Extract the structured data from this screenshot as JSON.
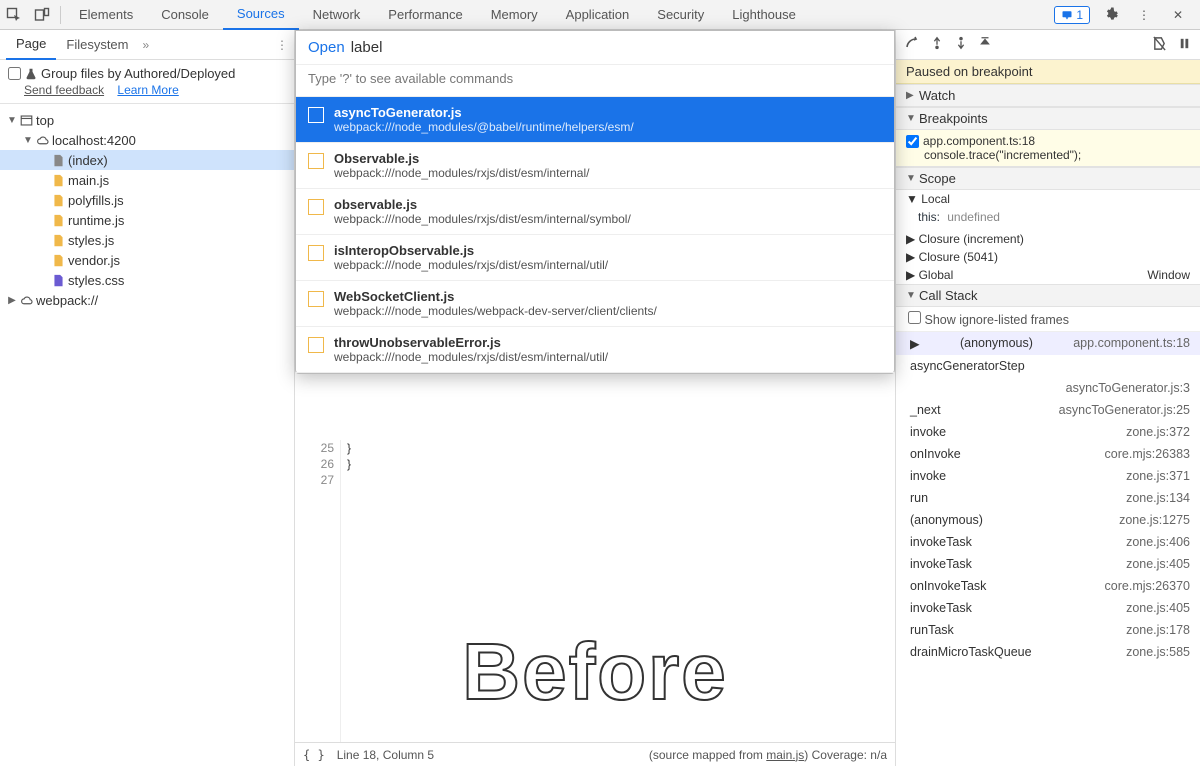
{
  "topTabs": [
    "Elements",
    "Console",
    "Sources",
    "Network",
    "Performance",
    "Memory",
    "Application",
    "Security",
    "Lighthouse"
  ],
  "activeTopTab": "Sources",
  "badgeCount": "1",
  "sidebar": {
    "tabs": [
      "Page",
      "Filesystem"
    ],
    "activeTab": "Page",
    "groupLabel": "Group files by Authored/Deployed",
    "feedback": "Send feedback",
    "learn": "Learn More",
    "tree": [
      {
        "depth": 0,
        "tw": "▼",
        "icon": "window",
        "label": "top"
      },
      {
        "depth": 1,
        "tw": "▼",
        "icon": "cloud",
        "label": "localhost:4200"
      },
      {
        "depth": 2,
        "tw": "",
        "icon": "file",
        "label": "(index)",
        "selected": true
      },
      {
        "depth": 2,
        "tw": "",
        "icon": "js",
        "label": "main.js"
      },
      {
        "depth": 2,
        "tw": "",
        "icon": "js",
        "label": "polyfills.js"
      },
      {
        "depth": 2,
        "tw": "",
        "icon": "js",
        "label": "runtime.js"
      },
      {
        "depth": 2,
        "tw": "",
        "icon": "js",
        "label": "styles.js"
      },
      {
        "depth": 2,
        "tw": "",
        "icon": "js",
        "label": "vendor.js"
      },
      {
        "depth": 2,
        "tw": "",
        "icon": "css",
        "label": "styles.css"
      },
      {
        "depth": 0,
        "tw": "▶",
        "icon": "cloud",
        "label": "webpack://"
      }
    ]
  },
  "popup": {
    "prefix": "Open",
    "query": "label",
    "hint": "Type '?' to see available commands",
    "items": [
      {
        "title": "asyncToGenerator.js",
        "path": "webpack:///node_modules/@babel/runtime/helpers/esm/",
        "sel": true
      },
      {
        "title": "Observable.js",
        "path": "webpack:///node_modules/rxjs/dist/esm/internal/"
      },
      {
        "title": "observable.js",
        "path": "webpack:///node_modules/rxjs/dist/esm/internal/symbol/"
      },
      {
        "title": "isInteropObservable.js",
        "path": "webpack:///node_modules/rxjs/dist/esm/internal/util/"
      },
      {
        "title": "WebSocketClient.js",
        "path": "webpack:///node_modules/webpack-dev-server/client/clients/"
      },
      {
        "title": "throwUnobservableError.js",
        "path": "webpack:///node_modules/rxjs/dist/esm/internal/util/"
      }
    ]
  },
  "code": {
    "startLine": 25,
    "lines": [
      "  }",
      "}",
      ""
    ]
  },
  "status": {
    "pos": "Line 18, Column 5",
    "mapped": "(source mapped from ",
    "mappedFile": "main.js",
    "coverage": ")  Coverage: n/a"
  },
  "right": {
    "paused": "Paused on breakpoint",
    "watch": "Watch",
    "breakpoints": "Breakpoints",
    "bpFile": "app.component.ts:18",
    "bpCode": "console.trace(\"incremented\");",
    "scope": "Scope",
    "scopeLocal": "Local",
    "scopeThis": "this:",
    "scopeThisVal": "undefined",
    "closure1": "Closure (increment)",
    "closure2": "Closure (5041)",
    "global": "Global",
    "globalVal": "Window",
    "callstack": "Call Stack",
    "showIgnored": "Show ignore-listed frames",
    "stack": [
      {
        "fn": "(anonymous)",
        "loc": "app.component.ts:18",
        "active": true
      },
      {
        "fn": "asyncGeneratorStep",
        "loc": ""
      },
      {
        "fn": "",
        "loc": "asyncToGenerator.js:3"
      },
      {
        "fn": "_next",
        "loc": "asyncToGenerator.js:25"
      },
      {
        "fn": "invoke",
        "loc": "zone.js:372"
      },
      {
        "fn": "onInvoke",
        "loc": "core.mjs:26383"
      },
      {
        "fn": "invoke",
        "loc": "zone.js:371"
      },
      {
        "fn": "run",
        "loc": "zone.js:134"
      },
      {
        "fn": "(anonymous)",
        "loc": "zone.js:1275"
      },
      {
        "fn": "invokeTask",
        "loc": "zone.js:406"
      },
      {
        "fn": "invokeTask",
        "loc": "zone.js:405"
      },
      {
        "fn": "onInvokeTask",
        "loc": "core.mjs:26370"
      },
      {
        "fn": "invokeTask",
        "loc": "zone.js:405"
      },
      {
        "fn": "runTask",
        "loc": "zone.js:178"
      },
      {
        "fn": "drainMicroTaskQueue",
        "loc": "zone.js:585"
      }
    ]
  },
  "overlay": "Before"
}
